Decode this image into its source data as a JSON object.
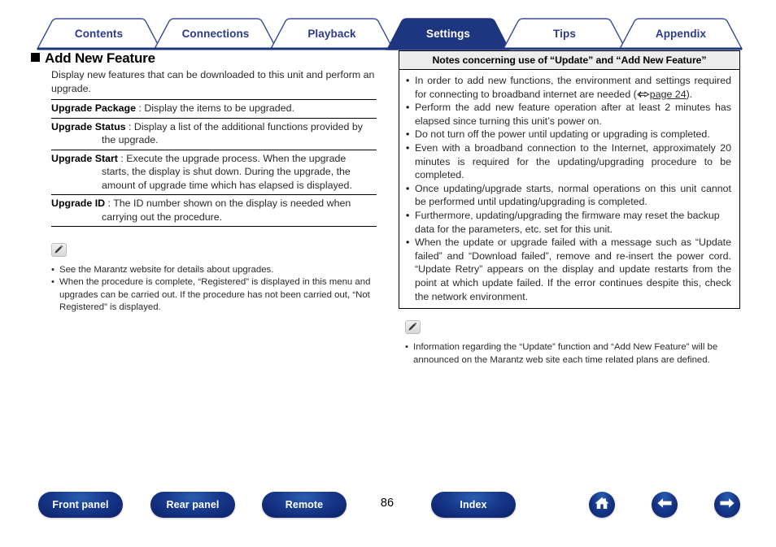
{
  "tabs": [
    {
      "label": "Contents",
      "active": false
    },
    {
      "label": "Connections",
      "active": false
    },
    {
      "label": "Playback",
      "active": false
    },
    {
      "label": "Settings",
      "active": true
    },
    {
      "label": "Tips",
      "active": false
    },
    {
      "label": "Appendix",
      "active": false
    }
  ],
  "left": {
    "heading": "Add New Feature",
    "intro": "Display new features that can be downloaded to this unit and perform an upgrade.",
    "definitions": [
      {
        "term": "Upgrade Package",
        "separator": " : ",
        "first_line": "Display the items to be upgraded.",
        "continuation": ""
      },
      {
        "term": "Upgrade Status",
        "separator": " : ",
        "first_line": "Display a list of the additional functions provided by",
        "continuation": "the upgrade."
      },
      {
        "term": "Upgrade Start",
        "separator": " : ",
        "first_line": "Execute the upgrade process. When the upgrade",
        "continuation": "starts, the display is shut down. During the upgrade, the amount of upgrade time which has elapsed is displayed."
      },
      {
        "term": "Upgrade ID",
        "separator": " : ",
        "first_line": "The ID number shown on the display is needed when",
        "continuation": "carrying out the procedure."
      }
    ],
    "notes": [
      "See the Marantz website for details about upgrades.",
      "When the procedure is complete, “Registered” is displayed in this menu and upgrades can be carried out. If the procedure has not been carried out, “Not Registered” is displayed."
    ]
  },
  "right": {
    "box_title": "Notes concerning use of “Update” and “Add New Feature”",
    "box_notes_pre": "In order to add new functions, the environment and settings required for connecting to broadband internet are needed (",
    "box_notes_link": "page 24",
    "box_notes_post": ").",
    "box_notes": [
      "Perform the add new feature operation after at least 2 minutes has elapsed since turning this unit’s power on.",
      "Do not turn off the power until updating or upgrading is completed.",
      "Even with a broadband connection to the Internet, approximately 20 minutes is required for the updating/upgrading procedure to be completed.",
      "Once updating/upgrade starts, normal operations on this unit cannot be performed until updating/upgrading is completed.",
      "Furthermore, updating/upgrading the firmware may reset the backup data for the parameters, etc. set for this unit.",
      "When the update or upgrade failed with a message such as “Update failed” and “Download failed”, remove and re-insert the power cord. “Update Retry” appears on the display and update restarts from the point at which update failed. If the error continues despite this, check the network environment."
    ],
    "notes": [
      "Information regarding the “Update” function and “Add New Feature” will be announced on the Marantz web site each time related plans are defined."
    ]
  },
  "footer": {
    "buttons": [
      {
        "label": "Front panel"
      },
      {
        "label": "Rear panel"
      },
      {
        "label": "Remote"
      },
      {
        "label": "Index"
      }
    ],
    "page_number": "86",
    "icons": [
      {
        "name": "home-icon"
      },
      {
        "name": "arrow-left-icon"
      },
      {
        "name": "arrow-right-icon"
      }
    ]
  },
  "colors": {
    "tab_active_bg": "#1e357f",
    "tab_text": "#2b3a8f",
    "rule": "#1e357f",
    "button_blue": "#17398c"
  }
}
